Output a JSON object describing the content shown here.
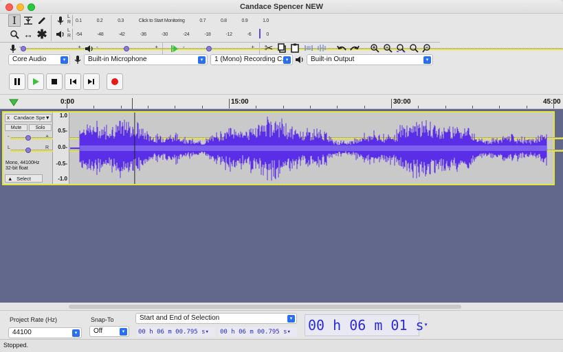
{
  "window": {
    "title": "Candace Spencer NEW"
  },
  "meters": {
    "record": {
      "ticks": [
        "0.1",
        "0.2",
        "0.3",
        "Click to Start Monitoring",
        "0.7",
        "0.8",
        "0.9",
        "1.0"
      ]
    },
    "playback": {
      "ticks": [
        "-54",
        "-48",
        "-42",
        "-36",
        "-30",
        "-24",
        "-18",
        "-12",
        "-6",
        "0"
      ]
    },
    "left": "L",
    "right": "R"
  },
  "mixer": {
    "mic_min": "-",
    "mic_max": "+",
    "mic_level": 0.0,
    "out_min": "-",
    "out_max": "+",
    "out_level": 0.5,
    "speed_min": "-",
    "speed_max": "+",
    "speed_level": 0.35
  },
  "devices": {
    "host": "Core Audio",
    "input": "Built-in Microphone",
    "channels": "1 (Mono) Recording C...",
    "output": "Built-in Output"
  },
  "ruler": {
    "labels": [
      {
        "text": "0:00",
        "t": 0
      },
      {
        "text": "15:00",
        "t": 15
      },
      {
        "text": "30:00",
        "t": 30
      },
      {
        "text": "45:00",
        "t": 45
      }
    ],
    "playhead_min": 6.02
  },
  "track": {
    "name": "Candace Spe▼",
    "close": "x",
    "mute": "Mute",
    "solo": "Solo",
    "gain_min": "-",
    "gain_max": "+",
    "pan_l": "L",
    "pan_r": "R",
    "info_line1": "Mono, 44100Hz",
    "info_line2": "32-bit float",
    "collapse": "▲",
    "select": "Select",
    "scale": [
      "1.0",
      "0.5-",
      "0.0-",
      "-0.5-",
      "-1.0"
    ],
    "wave_color": "#5a2ee6",
    "wave_start_min": 0.9,
    "wave_end_min": 45.0
  },
  "selection_bar": {
    "rate_label": "Project Rate (Hz)",
    "rate_value": "44100",
    "snap_label": "Snap-To",
    "snap_value": "Off",
    "mode": "Start and End of Selection",
    "start": "00 h 06 m 00.795 s",
    "end": "00 h 06 m 00.795 s",
    "position": "00 h 06 m 01 s"
  },
  "status": {
    "text": "Stopped."
  },
  "colors": {
    "accent": "#2a6ff2",
    "track_border": "#e5e53a",
    "background": "#62678c",
    "record": "#e41b1b",
    "play": "#3fbf3f"
  }
}
